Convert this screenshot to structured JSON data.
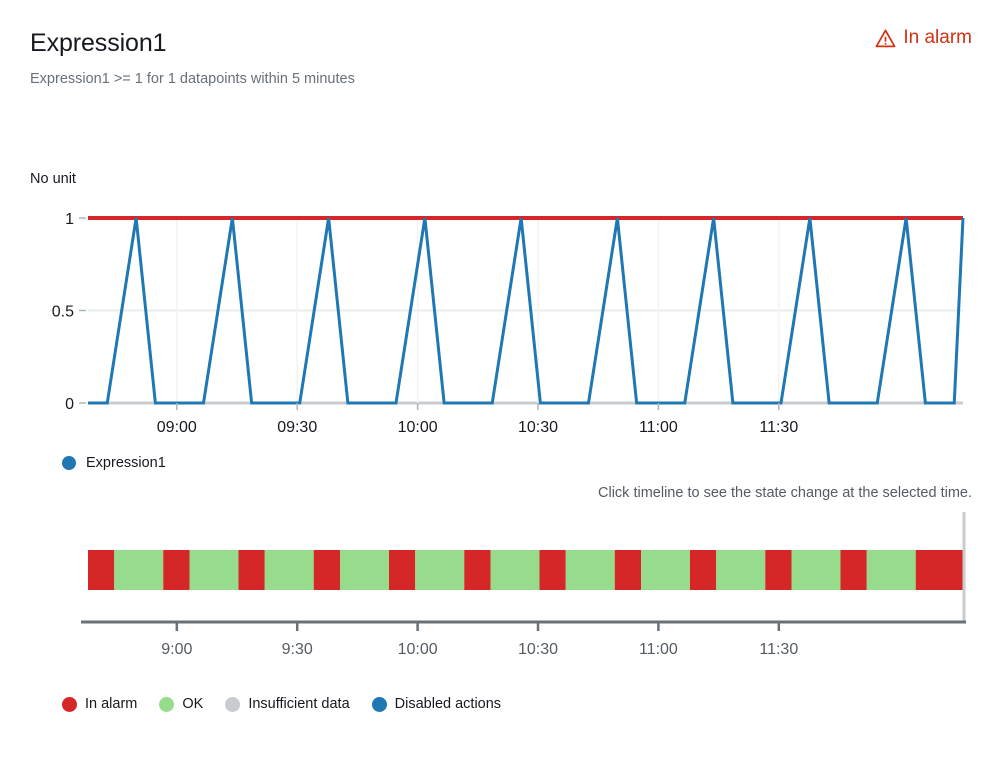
{
  "header": {
    "title": "Expression1",
    "subtitle": "Expression1 >= 1 for 1 datapoints within 5 minutes",
    "status": {
      "label": "In alarm",
      "icon": "warning-triangle-icon",
      "color": "#d13212"
    }
  },
  "chart": {
    "unit_label": "No unit",
    "legend": [
      {
        "label": "Expression1",
        "color": "#1f77b4"
      }
    ]
  },
  "timeline": {
    "hint": "Click timeline to see the state change at the selected time.",
    "legend": [
      {
        "label": "In alarm",
        "color": "#d62728"
      },
      {
        "label": "OK",
        "color": "#96dc8c"
      },
      {
        "label": "Insufficient data",
        "color": "#c8cbcf"
      },
      {
        "label": "Disabled actions",
        "color": "#1f77b4"
      }
    ]
  },
  "chart_data": {
    "type": "line",
    "title": "Expression1",
    "xlabel": "",
    "ylabel": "No unit",
    "ylim": [
      0,
      1
    ],
    "yticks": [
      0,
      0.5,
      1
    ],
    "ytick_labels": [
      "0",
      "0.5",
      "1"
    ],
    "grid": true,
    "legend_position": "bottom-left",
    "xticks": [
      0.1015,
      0.2391,
      0.3767,
      0.5143,
      0.6519,
      0.7895
    ],
    "xtick_labels": [
      "09:00",
      "09:30",
      "10:00",
      "10:30",
      "11:00",
      "11:30"
    ],
    "threshold": {
      "value": 1,
      "color": "#d62728",
      "label": "Expression1 >= 1"
    },
    "series": [
      {
        "name": "Expression1",
        "color": "#1f77b4",
        "x": [
          0.0,
          0.022,
          0.055,
          0.077,
          0.11,
          0.132,
          0.165,
          0.187,
          0.22,
          0.242,
          0.275,
          0.297,
          0.33,
          0.352,
          0.385,
          0.407,
          0.44,
          0.462,
          0.495,
          0.517,
          0.55,
          0.572,
          0.605,
          0.627,
          0.66,
          0.682,
          0.715,
          0.737,
          0.77,
          0.792,
          0.825,
          0.847,
          0.88,
          0.902,
          0.935,
          0.957,
          0.99,
          1.0
        ],
        "y": [
          0,
          0,
          1,
          0,
          0,
          0,
          1,
          0,
          0,
          0,
          1,
          0,
          0,
          0,
          1,
          0,
          0,
          0,
          1,
          0,
          0,
          0,
          1,
          0,
          0,
          0,
          1,
          0,
          0,
          0,
          1,
          0,
          0,
          0,
          1,
          0,
          0,
          1
        ]
      }
    ]
  },
  "timeline_data": {
    "type": "state-timeline",
    "xticks": [
      0.1015,
      0.2391,
      0.3767,
      0.5143,
      0.6519,
      0.7895
    ],
    "xtick_labels": [
      "9:00",
      "9:30",
      "10:00",
      "10:30",
      "11:00",
      "11:30"
    ],
    "segments": [
      {
        "state": "In alarm",
        "color": "#d62728",
        "start": 0.0,
        "end": 0.03
      },
      {
        "state": "OK",
        "color": "#96dc8c",
        "start": 0.03,
        "end": 0.086
      },
      {
        "state": "In alarm",
        "color": "#d62728",
        "start": 0.086,
        "end": 0.116
      },
      {
        "state": "OK",
        "color": "#96dc8c",
        "start": 0.116,
        "end": 0.172
      },
      {
        "state": "In alarm",
        "color": "#d62728",
        "start": 0.172,
        "end": 0.202
      },
      {
        "state": "OK",
        "color": "#96dc8c",
        "start": 0.202,
        "end": 0.258
      },
      {
        "state": "In alarm",
        "color": "#d62728",
        "start": 0.258,
        "end": 0.288
      },
      {
        "state": "OK",
        "color": "#96dc8c",
        "start": 0.288,
        "end": 0.344
      },
      {
        "state": "In alarm",
        "color": "#d62728",
        "start": 0.344,
        "end": 0.374
      },
      {
        "state": "OK",
        "color": "#96dc8c",
        "start": 0.374,
        "end": 0.43
      },
      {
        "state": "In alarm",
        "color": "#d62728",
        "start": 0.43,
        "end": 0.46
      },
      {
        "state": "OK",
        "color": "#96dc8c",
        "start": 0.46,
        "end": 0.516
      },
      {
        "state": "In alarm",
        "color": "#d62728",
        "start": 0.516,
        "end": 0.546
      },
      {
        "state": "OK",
        "color": "#96dc8c",
        "start": 0.546,
        "end": 0.602
      },
      {
        "state": "In alarm",
        "color": "#d62728",
        "start": 0.602,
        "end": 0.632
      },
      {
        "state": "OK",
        "color": "#96dc8c",
        "start": 0.632,
        "end": 0.688
      },
      {
        "state": "In alarm",
        "color": "#d62728",
        "start": 0.688,
        "end": 0.718
      },
      {
        "state": "OK",
        "color": "#96dc8c",
        "start": 0.718,
        "end": 0.774
      },
      {
        "state": "In alarm",
        "color": "#d62728",
        "start": 0.774,
        "end": 0.804
      },
      {
        "state": "OK",
        "color": "#96dc8c",
        "start": 0.804,
        "end": 0.86
      },
      {
        "state": "In alarm",
        "color": "#d62728",
        "start": 0.86,
        "end": 0.89
      },
      {
        "state": "OK",
        "color": "#96dc8c",
        "start": 0.89,
        "end": 0.946
      },
      {
        "state": "In alarm",
        "color": "#d62728",
        "start": 0.946,
        "end": 1.0
      }
    ]
  }
}
